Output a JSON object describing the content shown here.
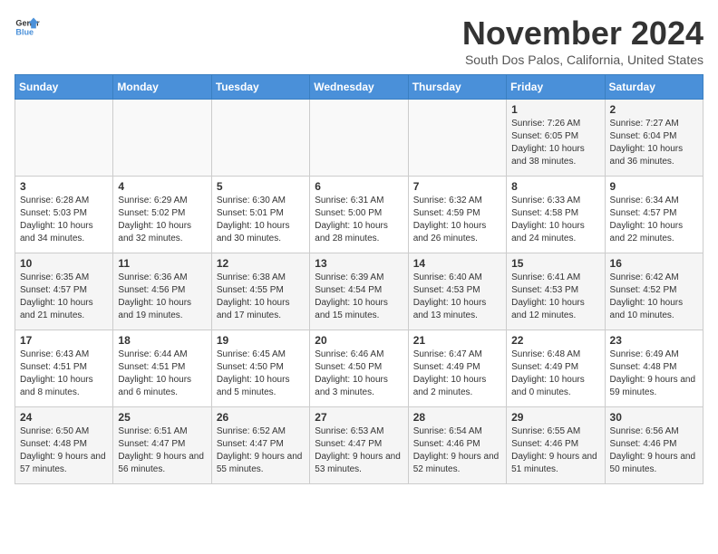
{
  "logo": {
    "general": "General",
    "blue": "Blue"
  },
  "title": "November 2024",
  "subtitle": "South Dos Palos, California, United States",
  "days_of_week": [
    "Sunday",
    "Monday",
    "Tuesday",
    "Wednesday",
    "Thursday",
    "Friday",
    "Saturday"
  ],
  "weeks": [
    [
      {
        "day": "",
        "info": ""
      },
      {
        "day": "",
        "info": ""
      },
      {
        "day": "",
        "info": ""
      },
      {
        "day": "",
        "info": ""
      },
      {
        "day": "",
        "info": ""
      },
      {
        "day": "1",
        "info": "Sunrise: 7:26 AM\nSunset: 6:05 PM\nDaylight: 10 hours and 38 minutes."
      },
      {
        "day": "2",
        "info": "Sunrise: 7:27 AM\nSunset: 6:04 PM\nDaylight: 10 hours and 36 minutes."
      }
    ],
    [
      {
        "day": "3",
        "info": "Sunrise: 6:28 AM\nSunset: 5:03 PM\nDaylight: 10 hours and 34 minutes."
      },
      {
        "day": "4",
        "info": "Sunrise: 6:29 AM\nSunset: 5:02 PM\nDaylight: 10 hours and 32 minutes."
      },
      {
        "day": "5",
        "info": "Sunrise: 6:30 AM\nSunset: 5:01 PM\nDaylight: 10 hours and 30 minutes."
      },
      {
        "day": "6",
        "info": "Sunrise: 6:31 AM\nSunset: 5:00 PM\nDaylight: 10 hours and 28 minutes."
      },
      {
        "day": "7",
        "info": "Sunrise: 6:32 AM\nSunset: 4:59 PM\nDaylight: 10 hours and 26 minutes."
      },
      {
        "day": "8",
        "info": "Sunrise: 6:33 AM\nSunset: 4:58 PM\nDaylight: 10 hours and 24 minutes."
      },
      {
        "day": "9",
        "info": "Sunrise: 6:34 AM\nSunset: 4:57 PM\nDaylight: 10 hours and 22 minutes."
      }
    ],
    [
      {
        "day": "10",
        "info": "Sunrise: 6:35 AM\nSunset: 4:57 PM\nDaylight: 10 hours and 21 minutes."
      },
      {
        "day": "11",
        "info": "Sunrise: 6:36 AM\nSunset: 4:56 PM\nDaylight: 10 hours and 19 minutes."
      },
      {
        "day": "12",
        "info": "Sunrise: 6:38 AM\nSunset: 4:55 PM\nDaylight: 10 hours and 17 minutes."
      },
      {
        "day": "13",
        "info": "Sunrise: 6:39 AM\nSunset: 4:54 PM\nDaylight: 10 hours and 15 minutes."
      },
      {
        "day": "14",
        "info": "Sunrise: 6:40 AM\nSunset: 4:53 PM\nDaylight: 10 hours and 13 minutes."
      },
      {
        "day": "15",
        "info": "Sunrise: 6:41 AM\nSunset: 4:53 PM\nDaylight: 10 hours and 12 minutes."
      },
      {
        "day": "16",
        "info": "Sunrise: 6:42 AM\nSunset: 4:52 PM\nDaylight: 10 hours and 10 minutes."
      }
    ],
    [
      {
        "day": "17",
        "info": "Sunrise: 6:43 AM\nSunset: 4:51 PM\nDaylight: 10 hours and 8 minutes."
      },
      {
        "day": "18",
        "info": "Sunrise: 6:44 AM\nSunset: 4:51 PM\nDaylight: 10 hours and 6 minutes."
      },
      {
        "day": "19",
        "info": "Sunrise: 6:45 AM\nSunset: 4:50 PM\nDaylight: 10 hours and 5 minutes."
      },
      {
        "day": "20",
        "info": "Sunrise: 6:46 AM\nSunset: 4:50 PM\nDaylight: 10 hours and 3 minutes."
      },
      {
        "day": "21",
        "info": "Sunrise: 6:47 AM\nSunset: 4:49 PM\nDaylight: 10 hours and 2 minutes."
      },
      {
        "day": "22",
        "info": "Sunrise: 6:48 AM\nSunset: 4:49 PM\nDaylight: 10 hours and 0 minutes."
      },
      {
        "day": "23",
        "info": "Sunrise: 6:49 AM\nSunset: 4:48 PM\nDaylight: 9 hours and 59 minutes."
      }
    ],
    [
      {
        "day": "24",
        "info": "Sunrise: 6:50 AM\nSunset: 4:48 PM\nDaylight: 9 hours and 57 minutes."
      },
      {
        "day": "25",
        "info": "Sunrise: 6:51 AM\nSunset: 4:47 PM\nDaylight: 9 hours and 56 minutes."
      },
      {
        "day": "26",
        "info": "Sunrise: 6:52 AM\nSunset: 4:47 PM\nDaylight: 9 hours and 55 minutes."
      },
      {
        "day": "27",
        "info": "Sunrise: 6:53 AM\nSunset: 4:47 PM\nDaylight: 9 hours and 53 minutes."
      },
      {
        "day": "28",
        "info": "Sunrise: 6:54 AM\nSunset: 4:46 PM\nDaylight: 9 hours and 52 minutes."
      },
      {
        "day": "29",
        "info": "Sunrise: 6:55 AM\nSunset: 4:46 PM\nDaylight: 9 hours and 51 minutes."
      },
      {
        "day": "30",
        "info": "Sunrise: 6:56 AM\nSunset: 4:46 PM\nDaylight: 9 hours and 50 minutes."
      }
    ]
  ]
}
